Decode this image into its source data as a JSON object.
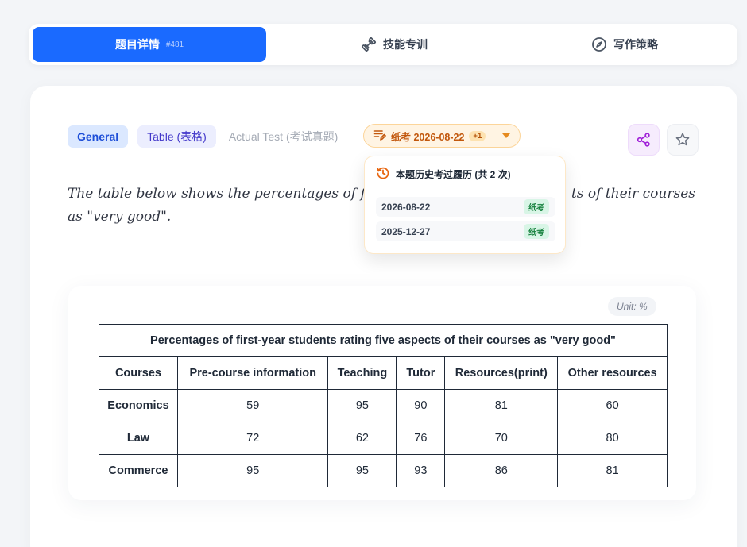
{
  "tabs": [
    {
      "label": "题目详情",
      "badge": "#481",
      "active": true,
      "icon": "none"
    },
    {
      "label": "技能专训",
      "icon": "dumbbell-icon"
    },
    {
      "label": "写作策略",
      "icon": "compass-icon"
    }
  ],
  "tags": {
    "general": "General",
    "table": "Table (表格)",
    "actual": "Actual Test (考试真题)"
  },
  "exam_pill": {
    "label": "纸考 2026-08-22",
    "extra": "+1"
  },
  "prompt": "The table below shows the percentages of first-year students rating five aspects of their courses as \"very good\".",
  "prompt_visible": {
    "line1_left": "The table below shows the percentages of first-",
    "line1_right": "ts of their courses",
    "line2": "as \"very good\"."
  },
  "history": {
    "title": "本题历史考过履历 (共 2 次)",
    "items": [
      {
        "date": "2026-08-22",
        "type": "纸考"
      },
      {
        "date": "2025-12-27",
        "type": "纸考"
      }
    ]
  },
  "unit": "Unit: %",
  "chart_data": {
    "type": "table",
    "title": "Percentages of first-year students rating five aspects of their courses as \"very good\"",
    "columns": [
      "Courses",
      "Pre-course information",
      "Teaching",
      "Tutor",
      "Resources(print)",
      "Other resources"
    ],
    "rows": [
      [
        "Economics",
        "59",
        "95",
        "90",
        "81",
        "60"
      ],
      [
        "Law",
        "72",
        "62",
        "76",
        "70",
        "80"
      ],
      [
        "Commerce",
        "95",
        "95",
        "93",
        "86",
        "81"
      ]
    ]
  },
  "colors": {
    "accent": "#1a6aff",
    "exam_orange": "#c2570c",
    "share_purple": "#a020d8"
  }
}
